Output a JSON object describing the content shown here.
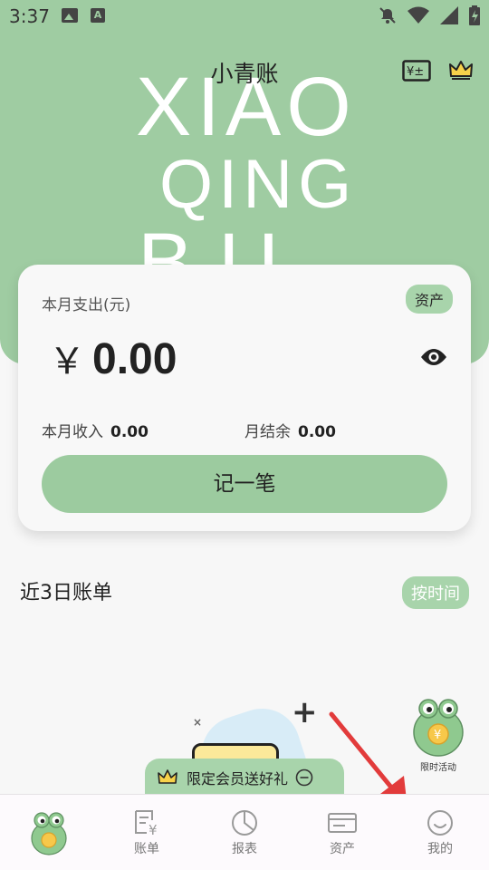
{
  "status_bar": {
    "time": "3:37",
    "icons": [
      "image-icon",
      "a-app-icon",
      "bell-off-icon",
      "wifi-icon",
      "signal-icon",
      "battery-icon"
    ]
  },
  "header": {
    "title": "小青账",
    "decor_lines": [
      "XIAO",
      "QING",
      "BU"
    ],
    "right_icons": [
      "currency-exchange-icon",
      "crown-icon"
    ],
    "accent_color": "#9fcca2"
  },
  "summary_card": {
    "label": "本月支出(元)",
    "asset_badge": "资产",
    "currency_symbol": "￥",
    "amount": "0.00",
    "income_label": "本月收入",
    "income_value": "0.00",
    "balance_label": "月结余",
    "balance_value": "0.00",
    "record_button": "记一笔"
  },
  "recent": {
    "title": "近3日账单",
    "sort_button": "按时间"
  },
  "promo": {
    "text": "限定会员送好礼"
  },
  "floating_activity": {
    "label": "限时活动"
  },
  "tabs": [
    {
      "label": "",
      "icon": "frog-home-icon",
      "active": true
    },
    {
      "label": "账单",
      "icon": "bill-icon"
    },
    {
      "label": "报表",
      "icon": "pie-chart-icon"
    },
    {
      "label": "资产",
      "icon": "card-icon"
    },
    {
      "label": "我的",
      "icon": "smile-icon"
    }
  ]
}
